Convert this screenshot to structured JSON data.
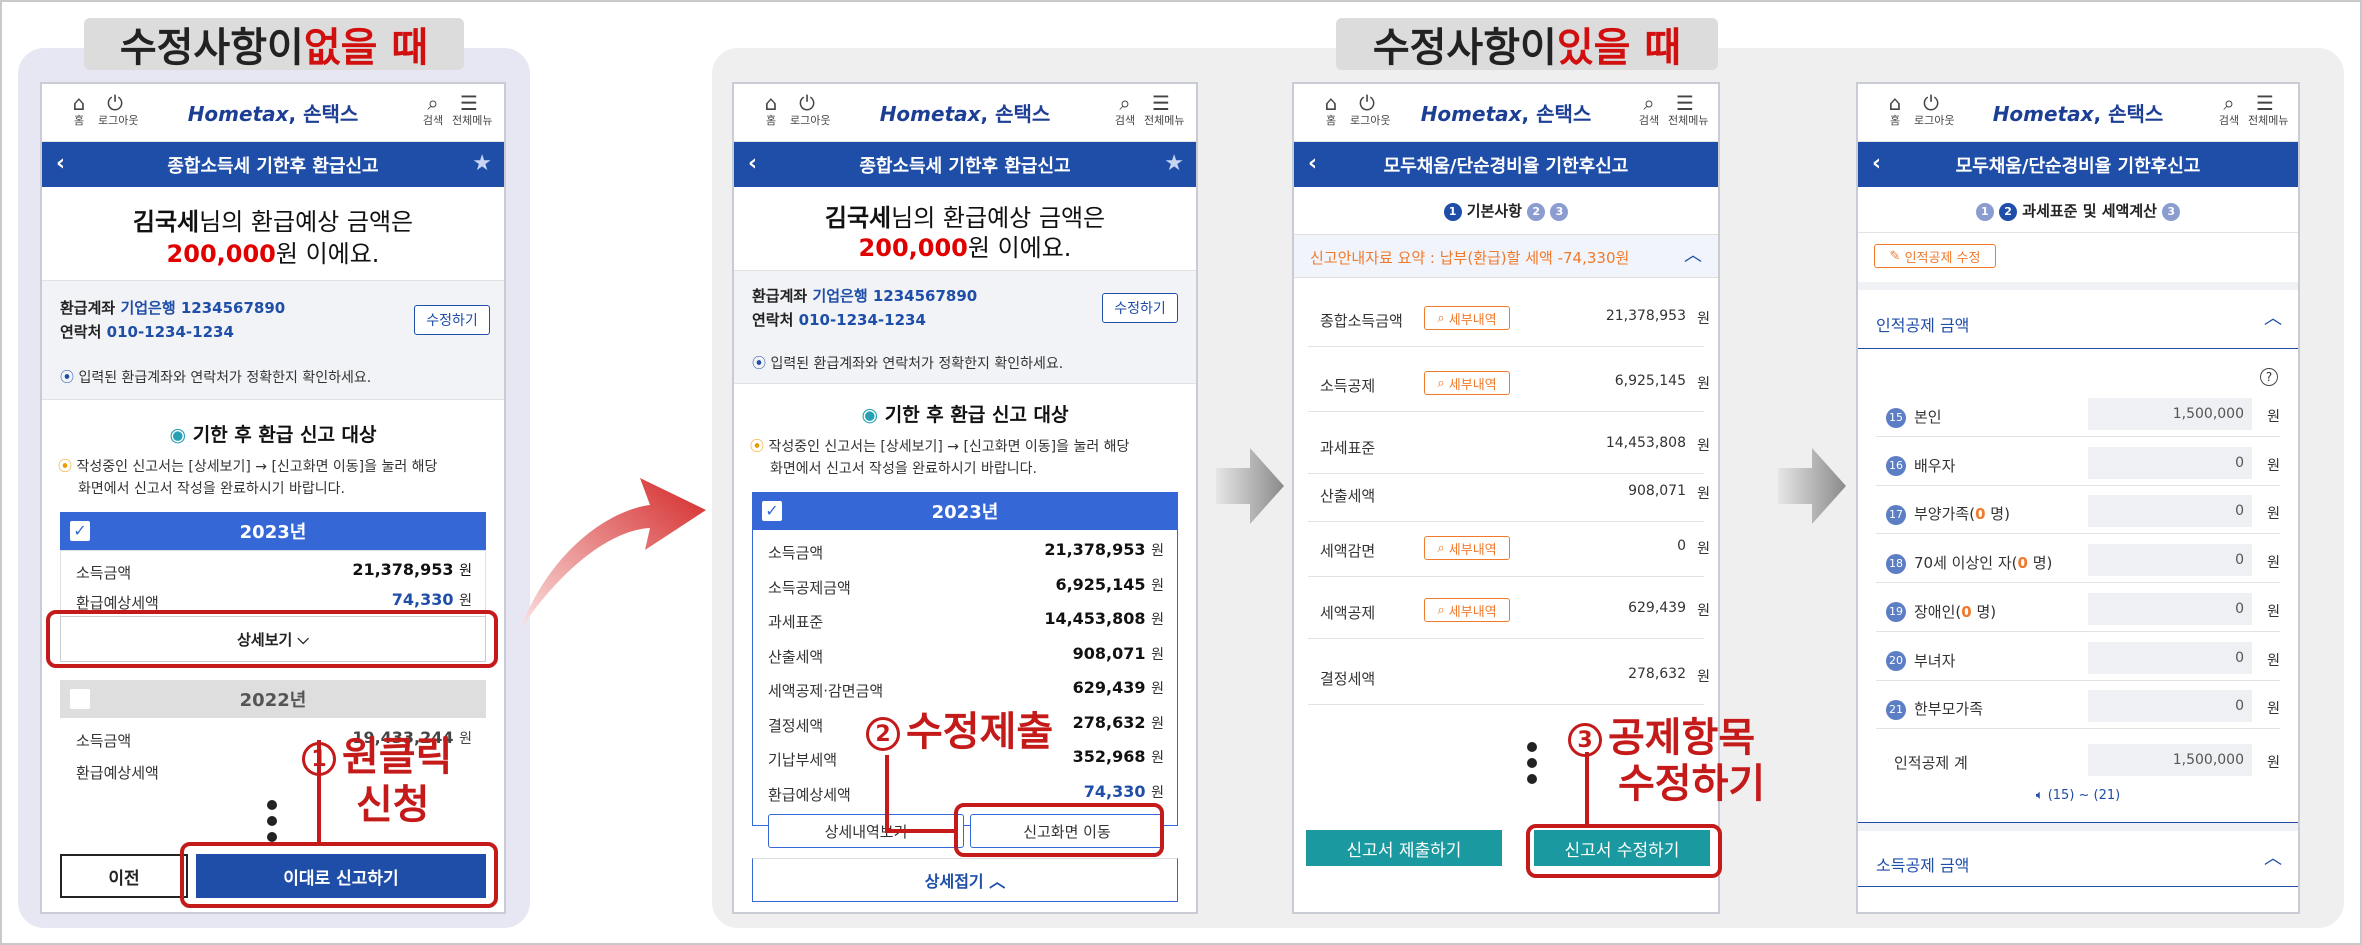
{
  "colors": {
    "accent": "#1f4ea8",
    "red": "#c41a1a",
    "teal": "#1a9aa0",
    "orange": "#f07a2c"
  },
  "headings": {
    "left": {
      "prefix": "수정사항이 ",
      "red": "없을 때"
    },
    "right": {
      "prefix": "수정사항이 ",
      "red": "있을 때"
    }
  },
  "nav": {
    "home": "홈",
    "logout": "로그아웃",
    "search": "검색",
    "menu": "전체메뉴",
    "logo_a": "Hometax",
    "logo_b": ", 손택스"
  },
  "screen1": {
    "title": "종합소득세 기한후 환급신고",
    "amount_line1_name": "김국세",
    "amount_line1_rest": "님의 환급예상 금액은",
    "amount_value": "200,000",
    "amount_suffix": "원 이에요.",
    "acct_label": "환급계좌",
    "acct_value": "기업은행 1234567890",
    "contact_label": "연락처",
    "contact_value": "010-1234-1234",
    "edit_button": "수정하기",
    "notice": "입력된 환급계좌와 연락처가 정확한지 확인하세요.",
    "section_title": "기한 후 환급 신고 대상",
    "guide_line1": "작성중인 신고서는 [상세보기] → [신고화면 이동]을 눌러 해당",
    "guide_line2": "화면에서 신고서 작성을 완료하시기 바랍니다.",
    "year1": "2023년",
    "y1_rows": [
      {
        "label": "소득금액",
        "value": "21,378,953",
        "unit": "원"
      },
      {
        "label": "환급예상세액",
        "value": "74,330",
        "unit": "원"
      }
    ],
    "detail_button": "상세보기",
    "year2": "2022년",
    "y2_rows": [
      {
        "label": "소득금액",
        "value": "19,433,244",
        "unit": "원"
      },
      {
        "label": "환급예상세액",
        "value": "",
        "unit": ""
      }
    ],
    "prev_button": "이전",
    "submit_button": "이대로 신고하기",
    "step_label": "원클릭",
    "step_label2": "신청",
    "step_no": "1"
  },
  "screen2": {
    "title": "종합소득세 기한후 환급신고",
    "amount_line1_name": "김국세",
    "amount_line1_rest": "님의 환급예상 금액은",
    "amount_value": "200,000",
    "amount_suffix": "원 이에요.",
    "acct_label": "환급계좌",
    "acct_value": "기업은행 1234567890",
    "contact_label": "연락처",
    "contact_value": "010-1234-1234",
    "edit_button": "수정하기",
    "notice": "입력된 환급계좌와 연락처가 정확한지 확인하세요.",
    "section_title": "기한 후 환급 신고 대상",
    "guide_line1": "작성중인 신고서는 [상세보기] → [신고화면 이동]을 눌러 해당",
    "guide_line2": "화면에서 신고서 작성을 완료하시기 바랍니다.",
    "year1": "2023년",
    "rows": [
      {
        "label": "소득금액",
        "value": "21,378,953",
        "unit": "원"
      },
      {
        "label": "소득공제금액",
        "value": "6,925,145",
        "unit": "원"
      },
      {
        "label": "과세표준",
        "value": "14,453,808",
        "unit": "원"
      },
      {
        "label": "산출세액",
        "value": "908,071",
        "unit": "원"
      },
      {
        "label": "세액공제·감면금액",
        "value": "629,439",
        "unit": "원"
      },
      {
        "label": "결정세액",
        "value": "278,632",
        "unit": "원"
      },
      {
        "label": "기납부세액",
        "value": "352,968",
        "unit": "원"
      },
      {
        "label": "환급예상세액",
        "value": "74,330",
        "unit": "원"
      }
    ],
    "detail_list_button": "상세내역보기",
    "move_button": "신고화면 이동",
    "fold_button": "상세접기",
    "step_label": "수정제출",
    "step_no": "2"
  },
  "screen3": {
    "title": "모두채움/단순경비율 기한후신고",
    "step1_label": "기본사항",
    "steps": [
      "1",
      "2",
      "3"
    ],
    "summary": "신고안내자료 요약 : 납부(환급)할 세액 -74,330원",
    "tag": "세부내역",
    "rows": [
      {
        "label": "종합소득금액",
        "value": "21,378,953",
        "unit": "원"
      },
      {
        "label": "소득공제",
        "value": "6,925,145",
        "unit": "원"
      },
      {
        "label": "과세표준",
        "value": "14,453,808",
        "unit": "원"
      },
      {
        "label": "산출세액",
        "value": "908,071",
        "unit": "원"
      },
      {
        "label": "세액감면",
        "value": "0",
        "unit": "원"
      },
      {
        "label": "세액공제",
        "value": "629,439",
        "unit": "원"
      },
      {
        "label": "결정세액",
        "value": "278,632",
        "unit": "원"
      }
    ],
    "submit_button": "신고서 제출하기",
    "modify_button": "신고서 수정하기",
    "step_label": "공제항목",
    "step_label2": "수정하기",
    "step_no": "3"
  },
  "screen4": {
    "title": "모두채움/단순경비율 기한후신고",
    "step2_label": "과세표준 및 세액계산",
    "steps": [
      "1",
      "2",
      "3"
    ],
    "edit_tag": "인적공제 수정",
    "acc1": "인적공제 금액",
    "help": "?",
    "rows": [
      {
        "no": "15",
        "label": "본인",
        "value": "1,500,000",
        "unit": "원"
      },
      {
        "no": "16",
        "label": "배우자",
        "value": "0",
        "unit": "원"
      },
      {
        "no": "17",
        "label": "부양가족(",
        "count": "0",
        "tail": " 명)",
        "value": "0",
        "unit": "원"
      },
      {
        "no": "18",
        "label": "70세 이상인 자(",
        "count": "0",
        "tail": " 명)",
        "value": "0",
        "unit": "원"
      },
      {
        "no": "19",
        "label": "장애인(",
        "count": "0",
        "tail": " 명)",
        "value": "0",
        "unit": "원"
      },
      {
        "no": "20",
        "label": "부녀자",
        "value": "0",
        "unit": "원"
      },
      {
        "no": "21",
        "label": "한부모가족",
        "value": "0",
        "unit": "원"
      }
    ],
    "total_label": "인적공제 계",
    "total_value": "1,500,000",
    "total_unit": "원",
    "range_note": "(15) ~ (21)",
    "acc2": "소득공제 금액"
  }
}
